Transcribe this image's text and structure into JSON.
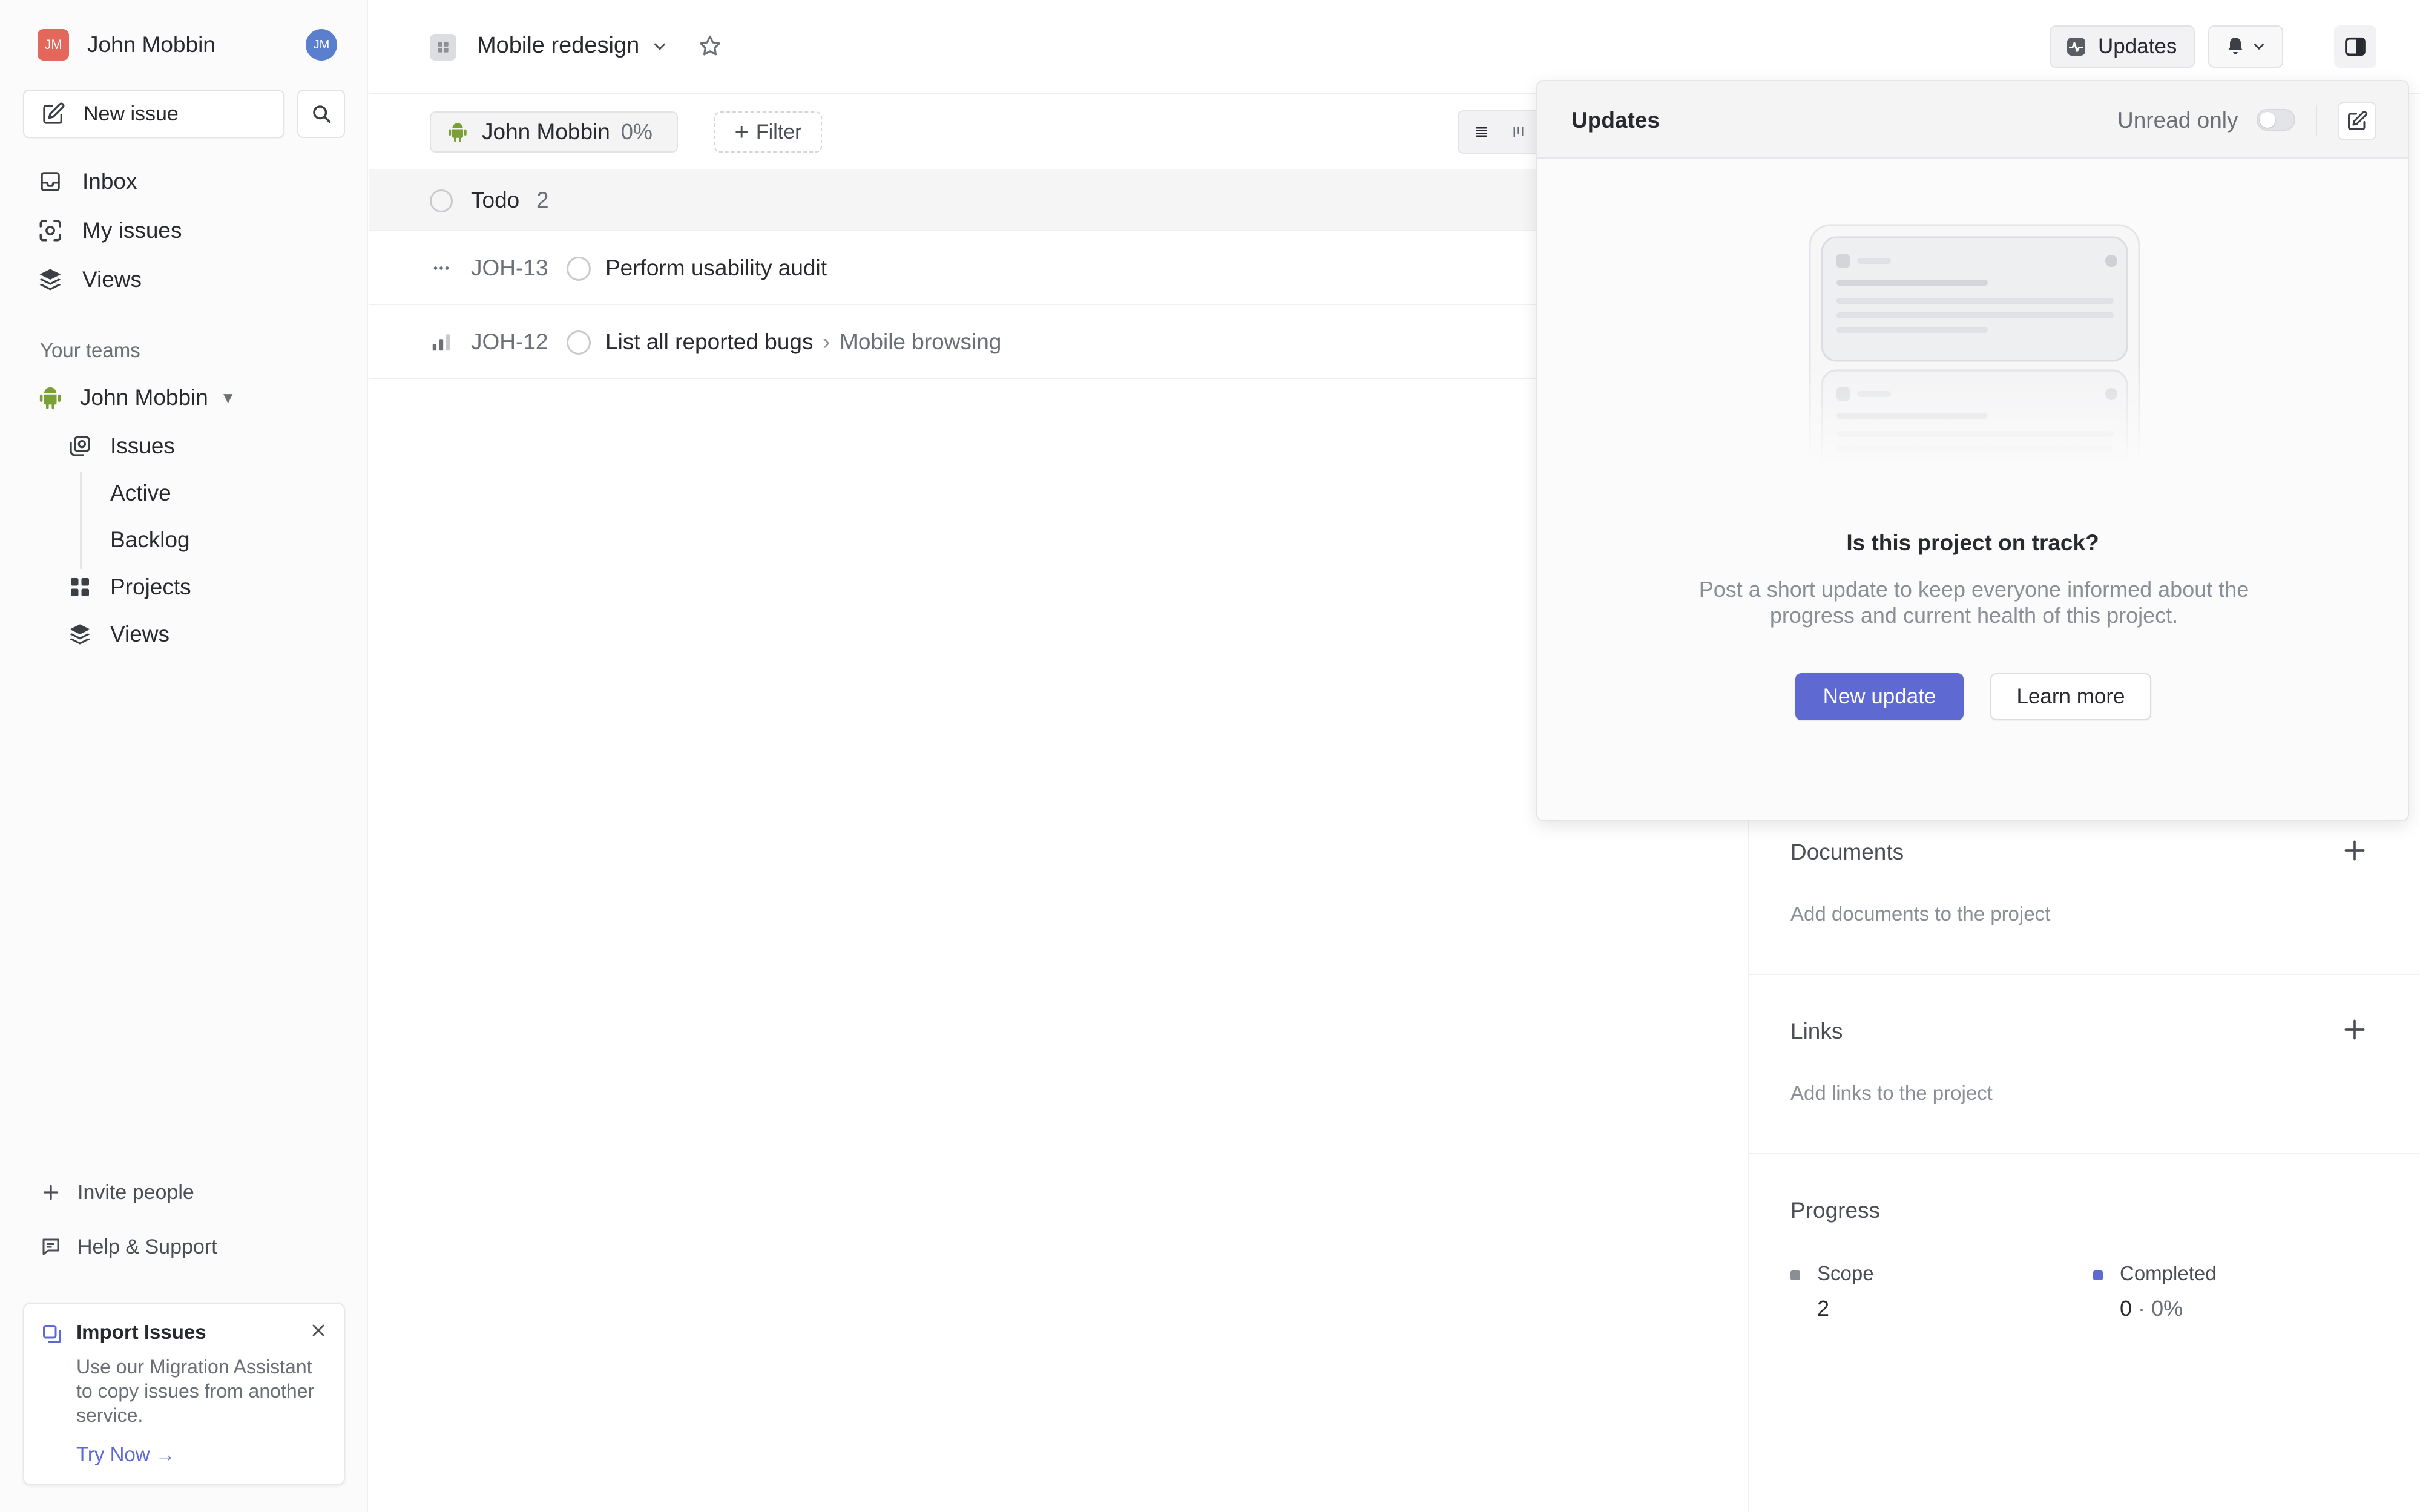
{
  "workspace": {
    "name": "John Mobbin",
    "logo_initials": "JM",
    "avatar_initials": "JM"
  },
  "sidebar": {
    "new_issue_label": "New issue",
    "nav": [
      {
        "label": "Inbox",
        "icon": "inbox-icon"
      },
      {
        "label": "My issues",
        "icon": "my-issues-icon"
      },
      {
        "label": "Views",
        "icon": "layers-icon"
      }
    ],
    "teams_label": "Your teams",
    "team": {
      "name": "John Mobbin",
      "caret": "▼",
      "items": [
        {
          "label": "Issues",
          "icon": "issues-icon"
        },
        {
          "label": "Active"
        },
        {
          "label": "Backlog"
        },
        {
          "label": "Projects",
          "icon": "projects-grid-icon"
        },
        {
          "label": "Views",
          "icon": "layers-icon"
        }
      ]
    },
    "invite_label": "Invite people",
    "help_label": "Help & Support",
    "import_card": {
      "title": "Import Issues",
      "description": "Use our Migration Assistant to copy issues from another service.",
      "link": "Try Now →"
    }
  },
  "header": {
    "project_name": "Mobile redesign",
    "updates_label": "Updates"
  },
  "filters": {
    "lead_name": "John Mobbin",
    "lead_progress": "0%",
    "filter_label": "Filter"
  },
  "list": {
    "group": {
      "label": "Todo",
      "count": "2"
    },
    "issues": [
      {
        "id": "JOH-13",
        "title": "Perform usability audit",
        "parent": ""
      },
      {
        "id": "JOH-12",
        "title": "List all reported bugs",
        "separator": "›",
        "parent": "Mobile browsing"
      }
    ]
  },
  "details": {
    "documents": {
      "title": "Documents",
      "hint": "Add documents to the project"
    },
    "links": {
      "title": "Links",
      "hint": "Add links to the project"
    },
    "progress": {
      "title": "Progress",
      "scope_label": "Scope",
      "scope_value": "2",
      "completed_label": "Completed",
      "completed_value": "0",
      "completed_sep": "·",
      "completed_pct": "0%"
    }
  },
  "updates_popover": {
    "title": "Updates",
    "unread_label": "Unread only",
    "unread_only": false,
    "question": "Is this project on track?",
    "description": "Post a short update to keep everyone informed about the progress and current health of this project.",
    "primary_button": "New update",
    "secondary_button": "Learn more"
  },
  "colors": {
    "accent": "#5e6ad2",
    "workspace_logo": "#e4675b",
    "avatar": "#5b7fcf",
    "team_icon": "#79a136"
  }
}
